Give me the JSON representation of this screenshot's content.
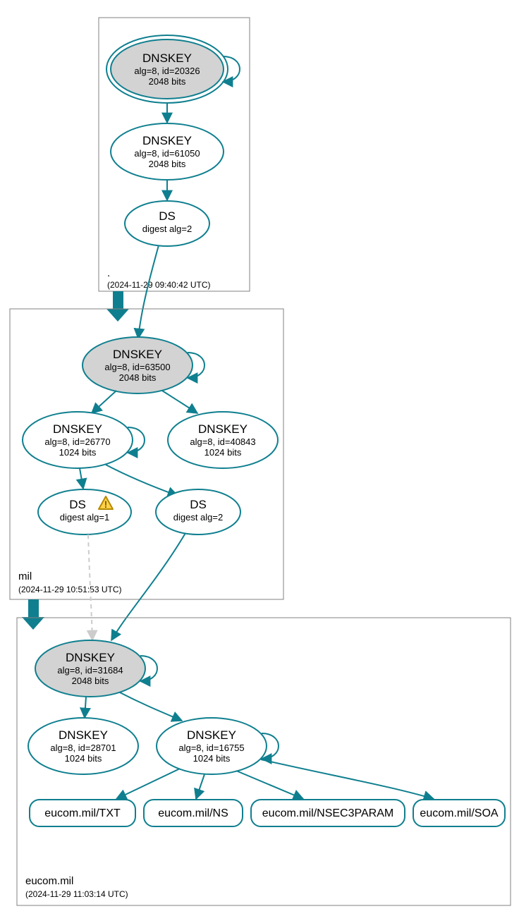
{
  "zones": {
    "root": {
      "label": ".",
      "timestamp": "(2024-11-29 09:40:42 UTC)"
    },
    "mil": {
      "label": "mil",
      "timestamp": "(2024-11-29 10:51:53 UTC)"
    },
    "eucom": {
      "label": "eucom.mil",
      "timestamp": "(2024-11-29 11:03:14 UTC)"
    }
  },
  "nodes": {
    "root_ksk": {
      "title": "DNSKEY",
      "line2": "alg=8, id=20326",
      "line3": "2048 bits"
    },
    "root_zsk": {
      "title": "DNSKEY",
      "line2": "alg=8, id=61050",
      "line3": "2048 bits"
    },
    "root_ds": {
      "title": "DS",
      "line2": "digest alg=2"
    },
    "mil_ksk": {
      "title": "DNSKEY",
      "line2": "alg=8, id=63500",
      "line3": "2048 bits"
    },
    "mil_zsk1": {
      "title": "DNSKEY",
      "line2": "alg=8, id=26770",
      "line3": "1024 bits"
    },
    "mil_zsk2": {
      "title": "DNSKEY",
      "line2": "alg=8, id=40843",
      "line3": "1024 bits"
    },
    "mil_ds1": {
      "title": "DS",
      "line2": "digest alg=1"
    },
    "mil_ds2": {
      "title": "DS",
      "line2": "digest alg=2"
    },
    "eucom_ksk": {
      "title": "DNSKEY",
      "line2": "alg=8, id=31684",
      "line3": "2048 bits"
    },
    "eucom_k2": {
      "title": "DNSKEY",
      "line2": "alg=8, id=28701",
      "line3": "1024 bits"
    },
    "eucom_k3": {
      "title": "DNSKEY",
      "line2": "alg=8, id=16755",
      "line3": "1024 bits"
    }
  },
  "rrsets": {
    "txt": "eucom.mil/TXT",
    "ns": "eucom.mil/NS",
    "nsec3": "eucom.mil/NSEC3PARAM",
    "soa": "eucom.mil/SOA"
  }
}
